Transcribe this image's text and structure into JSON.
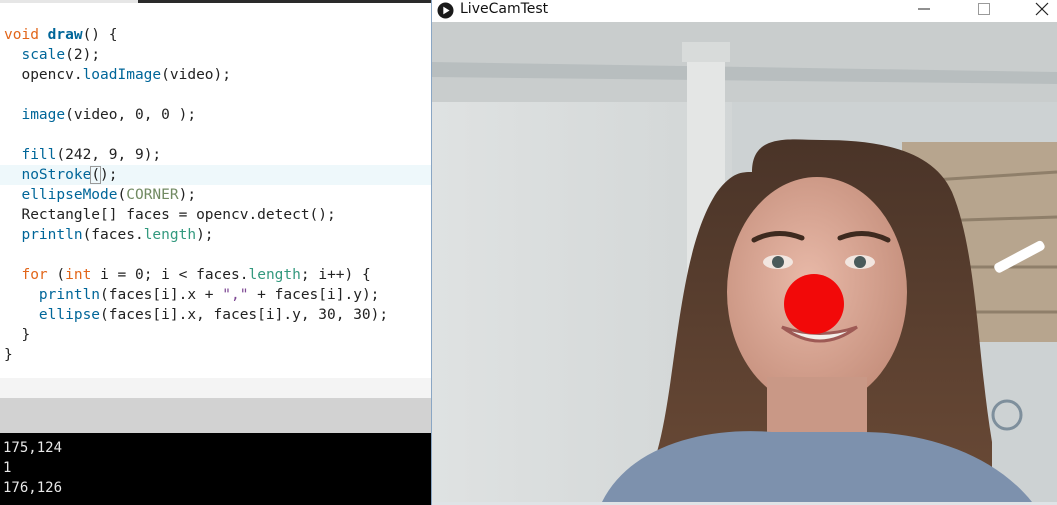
{
  "editor": {
    "lines": [
      {
        "prefix": "",
        "keyword": "void",
        "name": "draw",
        "rest": "() {"
      },
      {
        "call": "scale",
        "rest": "(2);"
      },
      {
        "object": "opencv.",
        "call": "loadImage",
        "rest": "(video);"
      },
      {
        "call": "image",
        "rest": "(video, 0, 0 );"
      },
      {
        "call": "fill",
        "rest": "(242, 9, 9);"
      },
      {
        "call": "noStroke",
        "cursor_char": "(",
        "rest": ");"
      },
      {
        "call": "ellipseMode",
        "open": "(",
        "constant": "CORNER",
        "close": ");"
      },
      {
        "text": "Rectangle[] faces = opencv.detect();"
      },
      {
        "call": "println",
        "open": "(faces.",
        "field": "length",
        "close": ");"
      },
      {
        "keyword": "for",
        "p1": " (",
        "type": "int",
        "p2": " i = 0; i < faces.",
        "field": "length",
        "p3": "; i++) {"
      },
      {
        "call": "println",
        "p1": "(faces[i].x + ",
        "string": "\",\"",
        "p2": " + faces[i].y);"
      },
      {
        "call": "ellipse",
        "rest": "(faces[i].x, faces[i].y, 30, 30);"
      },
      {
        "text": "}"
      },
      {
        "text": "}"
      }
    ]
  },
  "console": {
    "lines": [
      "175,124",
      "1",
      "176,126"
    ]
  },
  "sketch_window": {
    "title": "LiveCamTest",
    "controls": {
      "minimize": "minimize",
      "maximize": "maximize",
      "close": "close"
    }
  },
  "detection": {
    "marker_color": "#f20909"
  },
  "colors": {
    "console_bg": "#000000",
    "keyword": "#e2661a",
    "function": "#006699",
    "string": "#7d4793"
  }
}
